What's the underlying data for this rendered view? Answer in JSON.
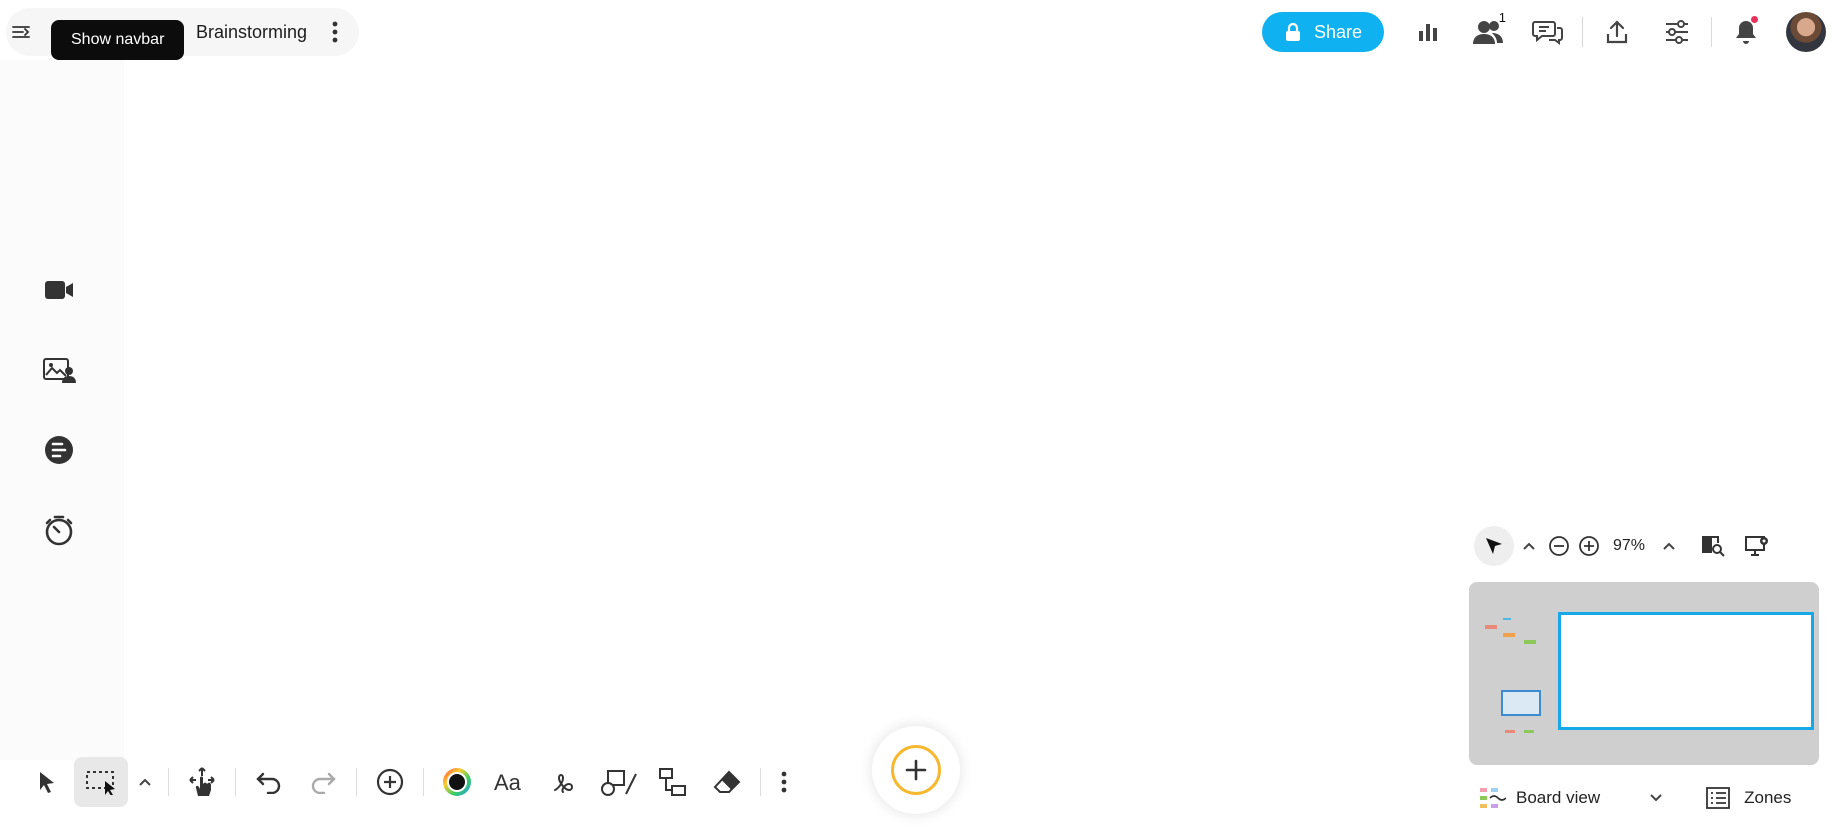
{
  "header": {
    "tooltip": "Show navbar",
    "board_title": "Brainstorming",
    "share_label": "Share",
    "collaborators_count": "1"
  },
  "icons": {
    "hamburger": "sidebar-toggle-icon",
    "lock": "lock-icon",
    "stats": "bar-chart-icon",
    "users": "users-icon",
    "chat": "chat-icon",
    "export": "upload-icon",
    "settings": "sliders-icon",
    "bell": "bell-icon"
  },
  "leftstrip": [
    "video-icon",
    "media-icon",
    "list-icon",
    "timer-icon"
  ],
  "toolbar": [
    "select",
    "marquee-select",
    "expand",
    "pan",
    "undo",
    "redo",
    "add",
    "color",
    "text",
    "pen",
    "shape",
    "connector",
    "eraser",
    "more"
  ],
  "zoom": {
    "level": "97%"
  },
  "bottom": {
    "board_view_label": "Board view",
    "zones_label": "Zones"
  },
  "colors": {
    "accent": "#0fb1f0",
    "add_ring": "#f5b82e",
    "minimap_viewport": "#17a8e8",
    "notification": "#e8315c"
  }
}
